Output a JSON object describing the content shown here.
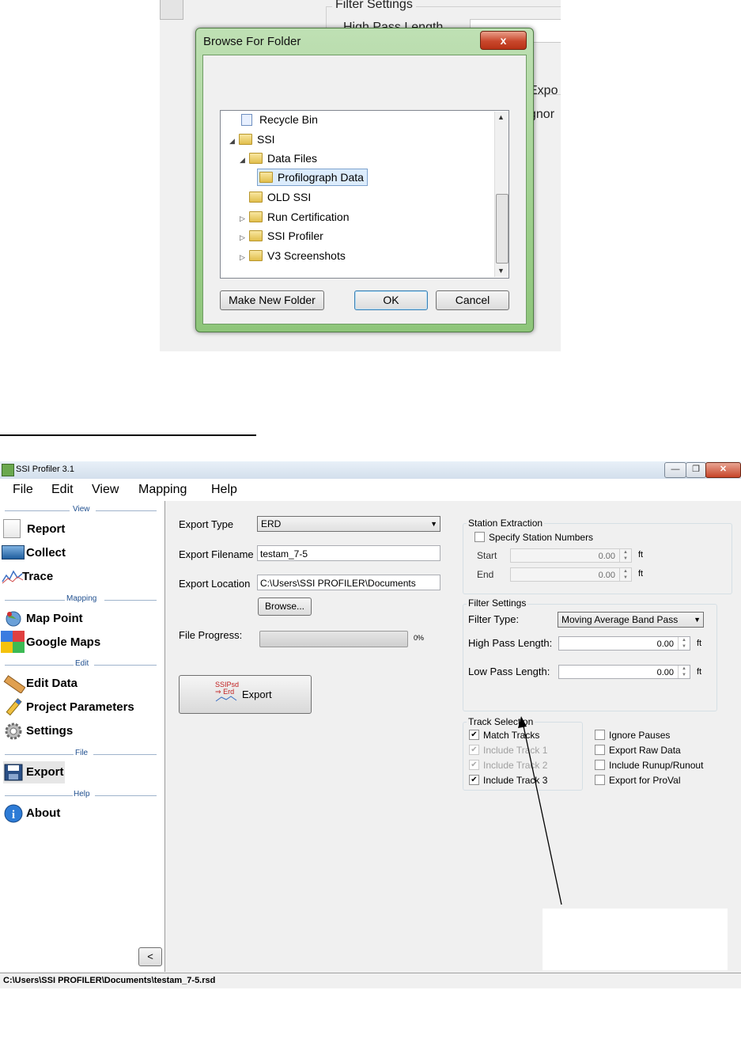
{
  "browse_dialog": {
    "background": {
      "filter_group_title": "Filter Settings",
      "partial_texts": [
        "High Pass Length",
        "Expo",
        "gnor"
      ]
    },
    "title": "Browse For Folder",
    "close_glyph": "x",
    "tree": [
      {
        "label": "Recycle Bin",
        "icon": "recycle-bin-icon",
        "indent": 0,
        "expander": ""
      },
      {
        "label": "SSI",
        "icon": "folder-icon",
        "indent": 0,
        "expander": "expanded"
      },
      {
        "label": "Data Files",
        "icon": "folder-icon",
        "indent": 1,
        "expander": "expanded"
      },
      {
        "label": "Profilograph Data",
        "icon": "folder-open-icon",
        "indent": 2,
        "expander": "",
        "selected": true
      },
      {
        "label": "OLD SSI",
        "icon": "folder-icon",
        "indent": 1,
        "expander": ""
      },
      {
        "label": "Run Certification",
        "icon": "folder-icon",
        "indent": 1,
        "expander": "collapsed"
      },
      {
        "label": "SSI Profiler",
        "icon": "folder-icon",
        "indent": 1,
        "expander": "collapsed"
      },
      {
        "label": "V3 Screenshots",
        "icon": "folder-icon",
        "indent": 1,
        "expander": "collapsed"
      }
    ],
    "buttons": {
      "make_new_folder": "Make New Folder",
      "ok": "OK",
      "cancel": "Cancel"
    }
  },
  "app": {
    "window_title": "SSI Profiler 3.1",
    "menu": [
      "File",
      "Edit",
      "View",
      "Mapping",
      "Help"
    ],
    "sidebar": {
      "sections": {
        "view": "View",
        "mapping": "Mapping",
        "edit": "Edit",
        "file": "File",
        "help": "Help"
      },
      "items": {
        "report": "Report",
        "collect": "Collect",
        "trace": "Trace",
        "map_point": "Map Point",
        "google_maps": "Google Maps",
        "edit_data": "Edit Data",
        "project_parameters": "Project Parameters",
        "settings": "Settings",
        "export": "Export",
        "about": "About"
      },
      "collapse_button": "<"
    },
    "export_panel": {
      "export_type_label": "Export Type",
      "export_type_value": "ERD",
      "export_filename_label": "Export Filename",
      "export_filename_value": "testam_7-5",
      "export_location_label": "Export Location",
      "export_location_value": "C:\\Users\\SSI PROFILER\\Documents",
      "browse_button": "Browse...",
      "file_progress_label": "File Progress:",
      "file_progress_percent": "0%",
      "file_progress_value": 0,
      "export_button": "Export",
      "export_icon_text_top": "SSIPsd",
      "export_icon_text_bottom": "Erd"
    },
    "station_extraction": {
      "title": "Station Extraction",
      "specify_label": "Specify Station Numbers",
      "specify_checked": false,
      "start_label": "Start",
      "start_value": "0.00",
      "end_label": "End",
      "end_value": "0.00",
      "unit": "ft"
    },
    "filter_settings": {
      "title": "Filter Settings",
      "filter_type_label": "Filter Type:",
      "filter_type_value": "Moving Average Band Pass",
      "high_pass_label": "High Pass Length:",
      "high_pass_value": "0.00",
      "low_pass_label": "Low Pass Length:",
      "low_pass_value": "0.00",
      "unit": "ft"
    },
    "track_selection": {
      "title": "Track Selection",
      "tracks": [
        {
          "label": "Match Tracks",
          "checked": true,
          "enabled": true
        },
        {
          "label": "Include Track 1",
          "checked": true,
          "enabled": false
        },
        {
          "label": "Include Track 2",
          "checked": true,
          "enabled": false
        },
        {
          "label": "Include Track 3",
          "checked": true,
          "enabled": true
        }
      ]
    },
    "options": [
      {
        "label": "Ignore Pauses",
        "checked": false
      },
      {
        "label": "Export Raw Data",
        "checked": false
      },
      {
        "label": "Include Runup/Runout",
        "checked": false
      },
      {
        "label": "Export for ProVal",
        "checked": false
      }
    ],
    "status_bar": "C:\\Users\\SSI PROFILER\\Documents\\testam_7-5.rsd"
  }
}
